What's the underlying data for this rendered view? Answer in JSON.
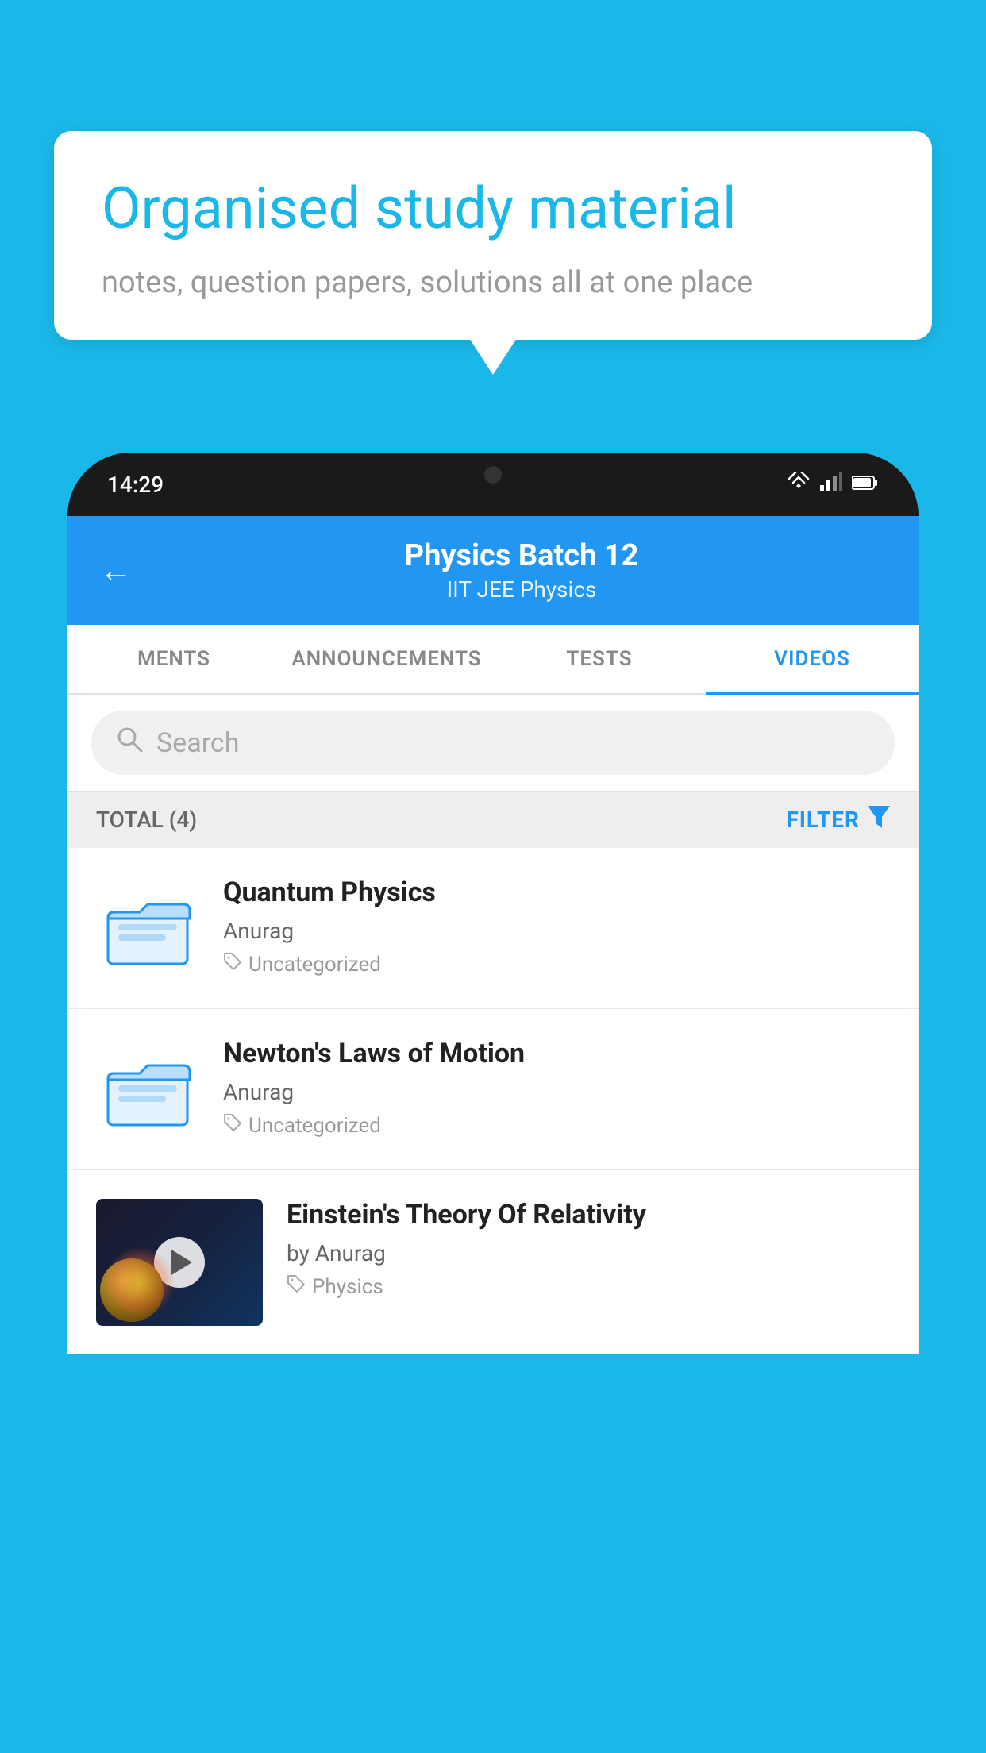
{
  "background_color": "#1ab8e8",
  "speech_bubble": {
    "title": "Organised study material",
    "subtitle": "notes, question papers, solutions all at one place"
  },
  "status_bar": {
    "time": "14:29",
    "wifi": "wifi-icon",
    "signal": "signal-icon",
    "battery": "battery-icon"
  },
  "app_header": {
    "back_label": "←",
    "title": "Physics Batch 12",
    "subtitle": "IIT JEE   Physics"
  },
  "tabs": [
    {
      "label": "MENTS",
      "active": false
    },
    {
      "label": "ANNOUNCEMENTS",
      "active": false
    },
    {
      "label": "TESTS",
      "active": false
    },
    {
      "label": "VIDEOS",
      "active": true
    }
  ],
  "search": {
    "placeholder": "Search"
  },
  "filter_row": {
    "total_label": "TOTAL (4)",
    "filter_label": "FILTER"
  },
  "videos": [
    {
      "id": 1,
      "title": "Quantum Physics",
      "author": "Anurag",
      "tag": "Uncategorized",
      "has_thumb": false
    },
    {
      "id": 2,
      "title": "Newton's Laws of Motion",
      "author": "Anurag",
      "tag": "Uncategorized",
      "has_thumb": false
    },
    {
      "id": 3,
      "title": "Einstein's Theory Of Relativity",
      "author": "by Anurag",
      "tag": "Physics",
      "has_thumb": true
    }
  ]
}
